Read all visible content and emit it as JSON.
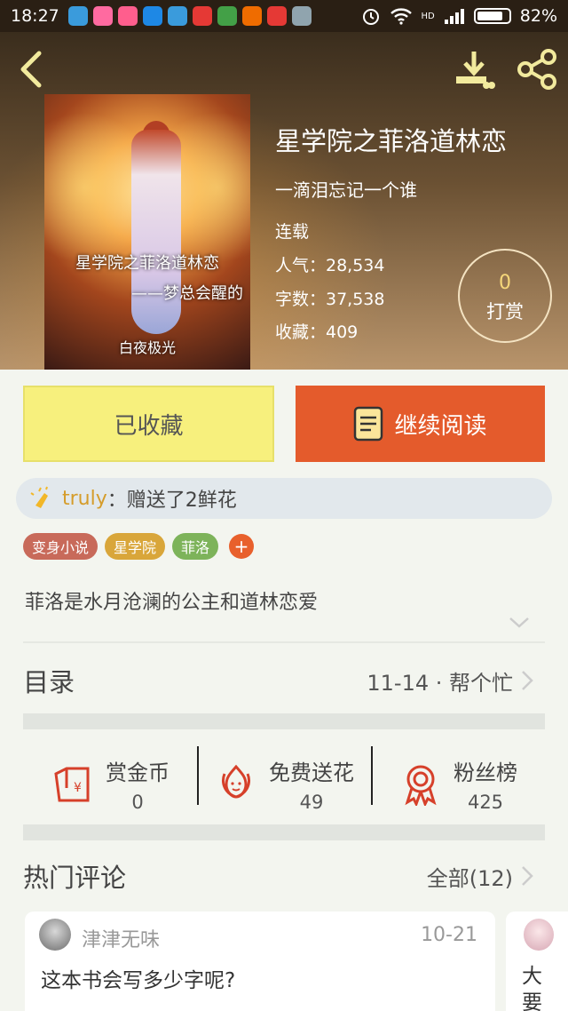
{
  "status_bar": {
    "time": "18:27",
    "battery": "82%",
    "battery_level": 0.82,
    "signal_label": "HD",
    "notification_colors": [
      "#3a9bdc",
      "#ff6aa0",
      "#ff5e8d",
      "#1e88e5",
      "#3a9bdc",
      "#e53935",
      "#43a047",
      "#ef6c00",
      "#e53935",
      "#90a4ae"
    ]
  },
  "header": {
    "back_icon": "chevron-left-icon",
    "download_icon": "download-icon",
    "share_icon": "share-icon"
  },
  "book": {
    "cover_title": "星学院之菲洛道林恋",
    "cover_subtitle": "——梦总会醒的",
    "cover_credit": "白夜极光",
    "title": "星学院之菲洛道林恋",
    "author": "一滴泪忘记一个谁",
    "status": "连载",
    "popularity": "人气：28,534",
    "word_count": "字数：37,538",
    "favorites": "收藏：409",
    "tip_count": "0",
    "tip_label": "打赏"
  },
  "actions": {
    "collected_label": "已收藏",
    "read_label": "继续阅读",
    "collected_color": "#f7f07d",
    "read_color": "#e45b2c"
  },
  "flower_notice": {
    "user": "truly",
    "text": "：赠送了2鲜花"
  },
  "tags": [
    {
      "label": "变身小说",
      "color": "#c86a5a"
    },
    {
      "label": "星学院",
      "color": "#d9a63a"
    },
    {
      "label": "菲洛",
      "color": "#7db35a"
    }
  ],
  "tag_add": "+",
  "description": "菲洛是水月沧澜的公主和道林恋爱",
  "toc": {
    "title": "目录",
    "latest": "11-14 · 帮个忙"
  },
  "stats": [
    {
      "label": "赏金币",
      "value": "0",
      "icon": "red-envelope-icon"
    },
    {
      "label": "免费送花",
      "value": "49",
      "icon": "flower-icon"
    },
    {
      "label": "粉丝榜",
      "value": "425",
      "icon": "medal-icon"
    }
  ],
  "comments": {
    "title": "热门评论",
    "all_label": "全部(12)",
    "items": [
      {
        "user": "津津无味",
        "date": "10-21",
        "text": "这本书会写多少字呢?"
      },
      {
        "user": "",
        "date": "",
        "text": "大要"
      }
    ]
  }
}
